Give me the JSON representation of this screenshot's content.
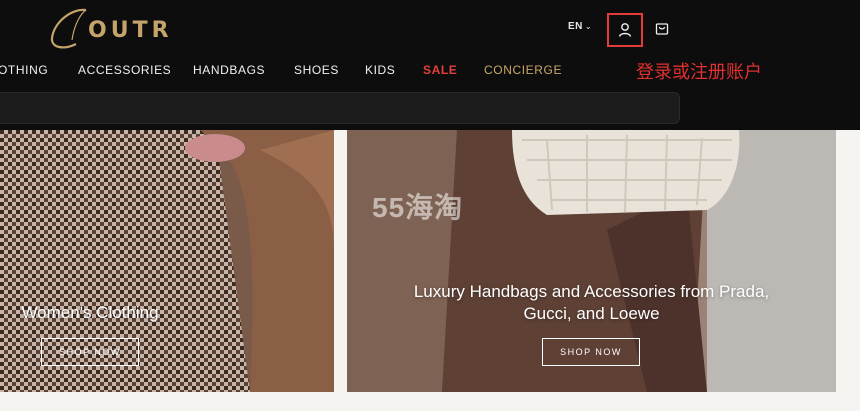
{
  "brand": {
    "name": "OUTR"
  },
  "header": {
    "language": "EN",
    "annotation": "登录或注册账户"
  },
  "nav": {
    "items": [
      {
        "label": "OTHING"
      },
      {
        "label": "ACCESSORIES"
      },
      {
        "label": "HANDBAGS"
      },
      {
        "label": "SHOES"
      },
      {
        "label": "KIDS"
      },
      {
        "label": "SALE"
      },
      {
        "label": "CONCIERGE"
      }
    ]
  },
  "hero": {
    "left": {
      "title": "Women's Clothing",
      "button": "SHOP NOW"
    },
    "right": {
      "title_line1": "Luxury Handbags and Accessories from Prada,",
      "title_line2": "Gucci, and Loewe",
      "button": "SHOP NOW"
    }
  },
  "watermark": "55海淘",
  "colors": {
    "accent_gold": "#c9a867",
    "sale_red": "#e2403b",
    "annotation_red": "#e1302f"
  }
}
